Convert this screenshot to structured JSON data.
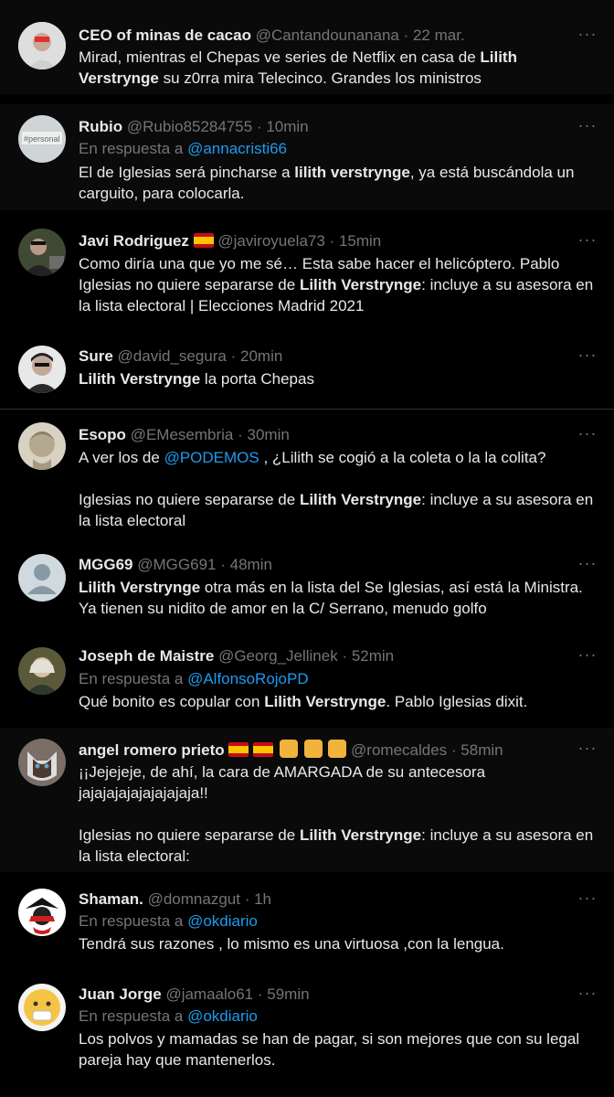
{
  "tweets": [
    {
      "name": "CEO of minas de cacao",
      "handle": "@Cantandounanana",
      "time": "· 22 mar.",
      "segments": [
        {
          "t": "Mirad, mientras el Chepas ve series de Netflix en casa de "
        },
        {
          "t": "Lilith Verstrynge",
          "b": true
        },
        {
          "t": " su z0rra mira Telecinco. Grandes los ministros"
        }
      ]
    },
    {
      "name": "Rubio",
      "handle": "@Rubio85284755",
      "time": "· 10min",
      "reply_prefix": "En respuesta a ",
      "reply_to": "@annacristi66",
      "segments": [
        {
          "t": "El de Iglesias será pincharse a "
        },
        {
          "t": "lilith verstrynge",
          "b": true
        },
        {
          "t": ", ya está buscándola un carguito, para colocarla."
        }
      ]
    },
    {
      "name": "Javi Rodriguez",
      "handle": "@javiroyuela73",
      "time": "· 15min",
      "segments": [
        {
          "t": "Como diría una que yo me sé… Esta sabe hacer el helicóptero. Pablo Iglesias no quiere separarse de "
        },
        {
          "t": "Lilith Verstrynge",
          "b": true
        },
        {
          "t": ": incluye a su asesora en la lista electoral | Elecciones Madrid 2021"
        }
      ]
    },
    {
      "name": "Sure",
      "handle": "@david_segura",
      "time": "· 20min",
      "segments": [
        {
          "t": "Lilith Verstrynge",
          "b": true
        },
        {
          "t": " la porta Chepas"
        }
      ]
    },
    {
      "name": "Esopo",
      "handle": "@EMesembria",
      "time": "· 30min",
      "segments": [
        {
          "t": "A ver los de "
        },
        {
          "t": "@PODEMOS",
          "m": true
        },
        {
          "t": " , ¿Lilith se cogió a la coleta o la la colita?"
        },
        {
          "br": 2
        },
        {
          "t": "Iglesias no quiere separarse de "
        },
        {
          "t": "Lilith Verstrynge",
          "b": true
        },
        {
          "t": ": incluye a su asesora en la lista electoral"
        }
      ]
    },
    {
      "name": "MGG69",
      "handle": "@MGG691",
      "time": "· 48min",
      "segments": [
        {
          "t": "Lilith  Verstrynge",
          "b": true
        },
        {
          "t": " otra más en la lista del Se Iglesias, así está la Ministra. Ya tienen su nidito de amor en la C/ Serrano, menudo golfo"
        }
      ]
    },
    {
      "name": "Joseph de Maistre",
      "handle": "@Georg_Jellinek",
      "time": "· 52min",
      "reply_prefix": "En respuesta a ",
      "reply_to": "@AlfonsoRojoPD",
      "segments": [
        {
          "t": "Qué bonito es copular con "
        },
        {
          "t": "Lilith Verstrynge",
          "b": true
        },
        {
          "t": ". Pablo Iglesias dixit."
        }
      ]
    },
    {
      "name": "angel romero prieto",
      "handle": "@romecaldes",
      "time": "· 58min",
      "segments": [
        {
          "t": "¡¡Jejejeje, de ahí, la cara de AMARGADA de su antecesora jajajajajajajajajaja!!"
        },
        {
          "br": 2
        },
        {
          "t": "Iglesias no quiere separarse de "
        },
        {
          "t": "Lilith Verstrynge",
          "b": true
        },
        {
          "t": ": incluye a su asesora en la lista electoral:"
        }
      ]
    },
    {
      "name": "Shaman.",
      "handle": "@domnazgut",
      "time": "· 1h",
      "reply_prefix": "En respuesta a ",
      "reply_to": "@okdiario",
      "segments": [
        {
          "t": "Tendrá sus razones , lo mismo es una virtuosa ,con la lengua."
        }
      ]
    },
    {
      "name": "Juan Jorge",
      "handle": "@jamaalo61",
      "time": "· 59min",
      "reply_prefix": "En respuesta a ",
      "reply_to": "@okdiario",
      "segments": [
        {
          "t": "Los polvos y mamadas se han de pagar, si son mejores que con su legal pareja hay que mantenerlos."
        }
      ]
    }
  ],
  "more_glyph": "···",
  "colors": {
    "background": "#000000",
    "link": "#1d9bf0",
    "muted": "#71767b",
    "text": "#e7e9ea"
  }
}
